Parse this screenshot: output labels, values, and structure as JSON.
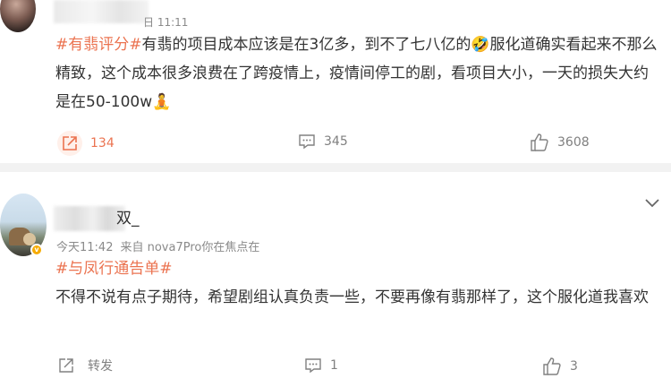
{
  "post1": {
    "time": "日 11:11",
    "topic": "#有翡评分#",
    "text_before_emoji": "有翡的项目成本应该是在3亿多，到不了七八亿的",
    "text_after_emoji": "服化道确实看起来不那么精致，这个成本很多浪费在了跨疫情上，疫情间停工的剧，看项目大小，一天的损失大约是在50-100w",
    "emoji_1": "🤣",
    "emoji_2": "🧘",
    "forward_count": "134",
    "comment_count": "345",
    "like_count": "3608"
  },
  "post2": {
    "username_suffix": "双_",
    "time": "今天11:42",
    "source": "来自 nova7Pro你在焦点在",
    "topic": "#与凤行通告单#",
    "text": "不得不说有点子期待，希望剧组认真负责一些，不要再像有翡那样了，这个服化道我喜欢",
    "forward_label": "转发",
    "comment_count": "1",
    "like_count": "3"
  },
  "colors": {
    "topic": "#eb7350",
    "meta": "#8a8a8a",
    "verified": "#f6ab00"
  }
}
